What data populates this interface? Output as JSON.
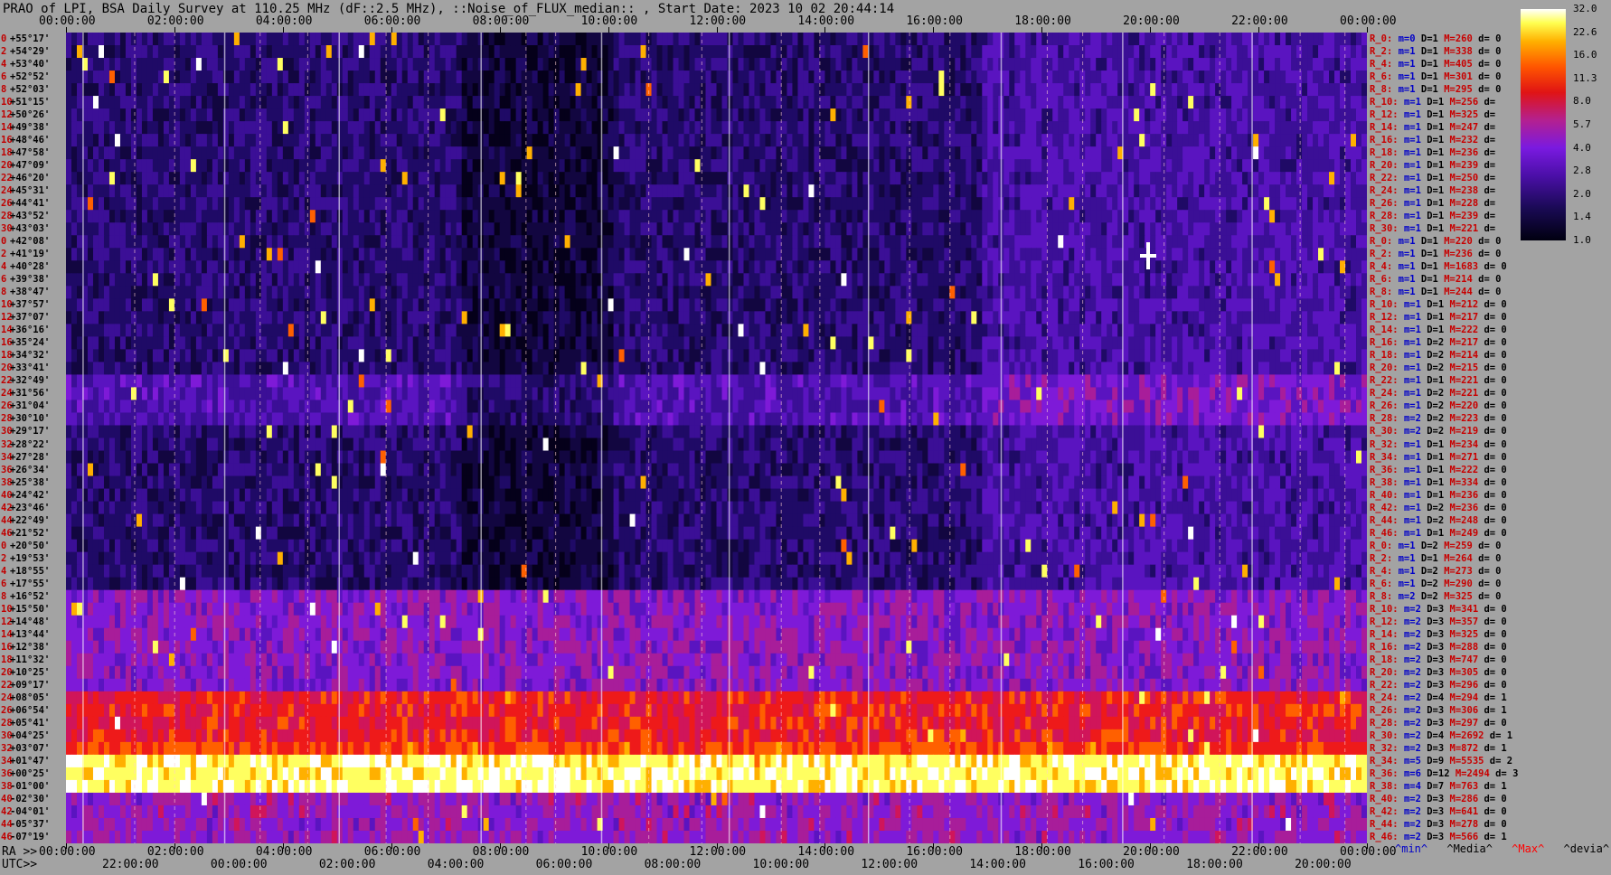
{
  "title": "PRAO of LPI, BSA Daily Survey at 110.25 MHz (dF::2.5 MHz), ::Noise_of_FLUX_median:: , Start Date: 2023 10 02 20:44:14",
  "ra_prefix": "RA >>",
  "utc_prefix": "UTC>>",
  "top_ticks": [
    "00:00:00",
    "02:00:00",
    "04:00:00",
    "06:00:00",
    "08:00:00",
    "10:00:00",
    "12:00:00",
    "14:00:00",
    "16:00:00",
    "18:00:00",
    "20:00:00",
    "22:00:00",
    "00:00:00"
  ],
  "bottom_ticks": [
    "00:00:00",
    "02:00:00",
    "04:00:00",
    "06:00:00",
    "08:00:00",
    "10:00:00",
    "12:00:00",
    "14:00:00",
    "16:00:00",
    "18:00:00",
    "20:00:00",
    "22:00:00",
    "00:00:00"
  ],
  "utc_ticks": [
    "22:00:00",
    "00:00:00",
    "02:00:00",
    "04:00:00",
    "06:00:00",
    "08:00:00",
    "10:00:00",
    "12:00:00",
    "14:00:00",
    "16:00:00",
    "18:00:00",
    "20:00:00"
  ],
  "colorbar_ticks": [
    "32.0",
    "22.6",
    "16.0",
    "11.3",
    "8.0",
    "5.7",
    "4.0",
    "2.8",
    "2.0",
    "1.4",
    "1.0"
  ],
  "legend": {
    "min": "^min^",
    "median": "^Media^",
    "max": "^Max^",
    "devia": "^devia^"
  },
  "colors": {
    "bg": "#a3a3a3",
    "red_label": "#c80000",
    "blue_label": "#0000c8",
    "max_label": "#ff0000"
  },
  "chart_data": {
    "type": "heatmap",
    "title": "PRAO of LPI, BSA Daily Survey at 110.25 MHz (dF::2.5 MHz), ::Noise_of_FLUX_median:: , Start Date: 2023 10 02 20:44:14",
    "x_axis_ticks": [
      "00:00:00",
      "02:00:00",
      "04:00:00",
      "06:00:00",
      "08:00:00",
      "10:00:00",
      "12:00:00",
      "14:00:00",
      "16:00:00",
      "18:00:00",
      "20:00:00",
      "22:00:00",
      "00:00:00"
    ],
    "colorbar_range": [
      1.0,
      32.0
    ],
    "colorbar_scale": "log",
    "rows": [
      {
        "idx": "0",
        "dec": "+55°17'",
        "r": "R_0:",
        "m": "m=0",
        "d": "D=1",
        "h": "M=260",
        "dv": "d= 0"
      },
      {
        "idx": "2",
        "dec": "+54°29'",
        "r": "R_2:",
        "m": "m=1",
        "d": "D=1",
        "h": "M=338",
        "dv": "d= 0"
      },
      {
        "idx": "4",
        "dec": "+53°40'",
        "r": "R_4:",
        "m": "m=1",
        "d": "D=1",
        "h": "M=405",
        "dv": "d= 0"
      },
      {
        "idx": "6",
        "dec": "+52°52'",
        "r": "R_6:",
        "m": "m=1",
        "d": "D=1",
        "h": "M=301",
        "dv": "d= 0"
      },
      {
        "idx": "8",
        "dec": "+52°03'",
        "r": "R_8:",
        "m": "m=1",
        "d": "D=1",
        "h": "M=295",
        "dv": "d= 0"
      },
      {
        "idx": "10",
        "dec": "+51°15'",
        "r": "R_10:",
        "m": "m=1",
        "d": "D=1",
        "h": "M=256",
        "dv": "d="
      },
      {
        "idx": "12",
        "dec": "+50°26'",
        "r": "R_12:",
        "m": "m=1",
        "d": "D=1",
        "h": "M=325",
        "dv": "d="
      },
      {
        "idx": "14",
        "dec": "+49°38'",
        "r": "R_14:",
        "m": "m=1",
        "d": "D=1",
        "h": "M=247",
        "dv": "d="
      },
      {
        "idx": "16",
        "dec": "+48°46'",
        "r": "R_16:",
        "m": "m=1",
        "d": "D=1",
        "h": "M=232",
        "dv": "d="
      },
      {
        "idx": "18",
        "dec": "+47°58'",
        "r": "R_18:",
        "m": "m=1",
        "d": "D=1",
        "h": "M=236",
        "dv": "d="
      },
      {
        "idx": "20",
        "dec": "+47°09'",
        "r": "R_20:",
        "m": "m=1",
        "d": "D=1",
        "h": "M=239",
        "dv": "d="
      },
      {
        "idx": "22",
        "dec": "+46°20'",
        "r": "R_22:",
        "m": "m=1",
        "d": "D=1",
        "h": "M=250",
        "dv": "d="
      },
      {
        "idx": "24",
        "dec": "+45°31'",
        "r": "R_24:",
        "m": "m=1",
        "d": "D=1",
        "h": "M=238",
        "dv": "d="
      },
      {
        "idx": "26",
        "dec": "+44°41'",
        "r": "R_26:",
        "m": "m=1",
        "d": "D=1",
        "h": "M=228",
        "dv": "d="
      },
      {
        "idx": "28",
        "dec": "+43°52'",
        "r": "R_28:",
        "m": "m=1",
        "d": "D=1",
        "h": "M=239",
        "dv": "d="
      },
      {
        "idx": "30",
        "dec": "+43°03'",
        "r": "R_30:",
        "m": "m=1",
        "d": "D=1",
        "h": "M=221",
        "dv": "d="
      },
      {
        "idx": "0",
        "dec": "+42°08'",
        "r": "R_0:",
        "m": "m=1",
        "d": "D=1",
        "h": "M=220",
        "dv": "d= 0"
      },
      {
        "idx": "2",
        "dec": "+41°19'",
        "r": "R_2:",
        "m": "m=1",
        "d": "D=1",
        "h": "M=236",
        "dv": "d= 0"
      },
      {
        "idx": "4",
        "dec": "+40°28'",
        "r": "R_4:",
        "m": "m=1",
        "d": "D=1",
        "h": "M=1683",
        "dv": "d= 0"
      },
      {
        "idx": "6",
        "dec": "+39°38'",
        "r": "R_6:",
        "m": "m=1",
        "d": "D=1",
        "h": "M=214",
        "dv": "d= 0"
      },
      {
        "idx": "8",
        "dec": "+38°47'",
        "r": "R_8:",
        "m": "m=1",
        "d": "D=1",
        "h": "M=244",
        "dv": "d= 0"
      },
      {
        "idx": "10",
        "dec": "+37°57'",
        "r": "R_10:",
        "m": "m=1",
        "d": "D=1",
        "h": "M=212",
        "dv": "d= 0"
      },
      {
        "idx": "12",
        "dec": "+37°07'",
        "r": "R_12:",
        "m": "m=1",
        "d": "D=1",
        "h": "M=217",
        "dv": "d= 0"
      },
      {
        "idx": "14",
        "dec": "+36°16'",
        "r": "R_14:",
        "m": "m=1",
        "d": "D=1",
        "h": "M=222",
        "dv": "d= 0"
      },
      {
        "idx": "16",
        "dec": "+35°24'",
        "r": "R_16:",
        "m": "m=1",
        "d": "D=2",
        "h": "M=217",
        "dv": "d= 0"
      },
      {
        "idx": "18",
        "dec": "+34°32'",
        "r": "R_18:",
        "m": "m=1",
        "d": "D=2",
        "h": "M=214",
        "dv": "d= 0"
      },
      {
        "idx": "20",
        "dec": "+33°41'",
        "r": "R_20:",
        "m": "m=1",
        "d": "D=2",
        "h": "M=215",
        "dv": "d= 0"
      },
      {
        "idx": "22",
        "dec": "+32°49'",
        "r": "R_22:",
        "m": "m=1",
        "d": "D=1",
        "h": "M=221",
        "dv": "d= 0"
      },
      {
        "idx": "24",
        "dec": "+31°56'",
        "r": "R_24:",
        "m": "m=1",
        "d": "D=2",
        "h": "M=221",
        "dv": "d= 0"
      },
      {
        "idx": "26",
        "dec": "+31°04'",
        "r": "R_26:",
        "m": "m=1",
        "d": "D=2",
        "h": "M=220",
        "dv": "d= 0"
      },
      {
        "idx": "28",
        "dec": "+30°10'",
        "r": "R_28:",
        "m": "m=2",
        "d": "D=2",
        "h": "M=223",
        "dv": "d= 0"
      },
      {
        "idx": "30",
        "dec": "+29°17'",
        "r": "R_30:",
        "m": "m=2",
        "d": "D=2",
        "h": "M=219",
        "dv": "d= 0"
      },
      {
        "idx": "32",
        "dec": "+28°22'",
        "r": "R_32:",
        "m": "m=1",
        "d": "D=1",
        "h": "M=234",
        "dv": "d= 0"
      },
      {
        "idx": "34",
        "dec": "+27°28'",
        "r": "R_34:",
        "m": "m=1",
        "d": "D=1",
        "h": "M=271",
        "dv": "d= 0"
      },
      {
        "idx": "36",
        "dec": "+26°34'",
        "r": "R_36:",
        "m": "m=1",
        "d": "D=1",
        "h": "M=222",
        "dv": "d= 0"
      },
      {
        "idx": "38",
        "dec": "+25°38'",
        "r": "R_38:",
        "m": "m=1",
        "d": "D=1",
        "h": "M=334",
        "dv": "d= 0"
      },
      {
        "idx": "40",
        "dec": "+24°42'",
        "r": "R_40:",
        "m": "m=1",
        "d": "D=1",
        "h": "M=236",
        "dv": "d= 0"
      },
      {
        "idx": "42",
        "dec": "+23°46'",
        "r": "R_42:",
        "m": "m=1",
        "d": "D=2",
        "h": "M=236",
        "dv": "d= 0"
      },
      {
        "idx": "44",
        "dec": "+22°49'",
        "r": "R_44:",
        "m": "m=1",
        "d": "D=2",
        "h": "M=248",
        "dv": "d= 0"
      },
      {
        "idx": "46",
        "dec": "+21°52'",
        "r": "R_46:",
        "m": "m=1",
        "d": "D=1",
        "h": "M=249",
        "dv": "d= 0"
      },
      {
        "idx": "0",
        "dec": "+20°50'",
        "r": "R_0:",
        "m": "m=1",
        "d": "D=2",
        "h": "M=259",
        "dv": "d= 0"
      },
      {
        "idx": "2",
        "dec": "+19°53'",
        "r": "R_2:",
        "m": "m=1",
        "d": "D=1",
        "h": "M=264",
        "dv": "d= 0"
      },
      {
        "idx": "4",
        "dec": "+18°55'",
        "r": "R_4:",
        "m": "m=1",
        "d": "D=2",
        "h": "M=273",
        "dv": "d= 0"
      },
      {
        "idx": "6",
        "dec": "+17°55'",
        "r": "R_6:",
        "m": "m=1",
        "d": "D=2",
        "h": "M=290",
        "dv": "d= 0"
      },
      {
        "idx": "8",
        "dec": "+16°52'",
        "r": "R_8:",
        "m": "m=2",
        "d": "D=2",
        "h": "M=325",
        "dv": "d= 0"
      },
      {
        "idx": "10",
        "dec": "+15°50'",
        "r": "R_10:",
        "m": "m=2",
        "d": "D=3",
        "h": "M=341",
        "dv": "d= 0"
      },
      {
        "idx": "12",
        "dec": "+14°48'",
        "r": "R_12:",
        "m": "m=2",
        "d": "D=3",
        "h": "M=357",
        "dv": "d= 0"
      },
      {
        "idx": "14",
        "dec": "+13°44'",
        "r": "R_14:",
        "m": "m=2",
        "d": "D=3",
        "h": "M=325",
        "dv": "d= 0"
      },
      {
        "idx": "16",
        "dec": "+12°38'",
        "r": "R_16:",
        "m": "m=2",
        "d": "D=3",
        "h": "M=288",
        "dv": "d= 0"
      },
      {
        "idx": "18",
        "dec": "+11°32'",
        "r": "R_18:",
        "m": "m=2",
        "d": "D=3",
        "h": "M=747",
        "dv": "d= 0"
      },
      {
        "idx": "20",
        "dec": "+10°25'",
        "r": "R_20:",
        "m": "m=2",
        "d": "D=3",
        "h": "M=305",
        "dv": "d= 0"
      },
      {
        "idx": "22",
        "dec": "+09°17'",
        "r": "R_22:",
        "m": "m=2",
        "d": "D=3",
        "h": "M=296",
        "dv": "d= 0"
      },
      {
        "idx": "24",
        "dec": "+08°05'",
        "r": "R_24:",
        "m": "m=2",
        "d": "D=4",
        "h": "M=294",
        "dv": "d= 1"
      },
      {
        "idx": "26",
        "dec": "+06°54'",
        "r": "R_26:",
        "m": "m=2",
        "d": "D=3",
        "h": "M=306",
        "dv": "d= 1"
      },
      {
        "idx": "28",
        "dec": "+05°41'",
        "r": "R_28:",
        "m": "m=2",
        "d": "D=3",
        "h": "M=297",
        "dv": "d= 0"
      },
      {
        "idx": "30",
        "dec": "+04°25'",
        "r": "R_30:",
        "m": "m=2",
        "d": "D=4",
        "h": "M=2692",
        "dv": "d= 1"
      },
      {
        "idx": "32",
        "dec": "+03°07'",
        "r": "R_32:",
        "m": "m=2",
        "d": "D=3",
        "h": "M=872",
        "dv": "d= 1"
      },
      {
        "idx": "34",
        "dec": "+01°47'",
        "r": "R_34:",
        "m": "m=5",
        "d": "D=9",
        "h": "M=5535",
        "dv": "d= 2"
      },
      {
        "idx": "36",
        "dec": "+00°25'",
        "r": "R_36:",
        "m": "m=6",
        "d": "D=12",
        "h": "M=2494",
        "dv": "d= 3"
      },
      {
        "idx": "38",
        "dec": "-01°00'",
        "r": "R_38:",
        "m": "m=4",
        "d": "D=7",
        "h": "M=763",
        "dv": "d= 1"
      },
      {
        "idx": "40",
        "dec": "-02°30'",
        "r": "R_40:",
        "m": "m=2",
        "d": "D=3",
        "h": "M=286",
        "dv": "d= 0"
      },
      {
        "idx": "42",
        "dec": "-04°01'",
        "r": "R_42:",
        "m": "m=2",
        "d": "D=3",
        "h": "M=641",
        "dv": "d= 0"
      },
      {
        "idx": "44",
        "dec": "-05°37'",
        "r": "R_44:",
        "m": "m=2",
        "d": "D=3",
        "h": "M=278",
        "dv": "d= 0"
      },
      {
        "idx": "46",
        "dec": "-07°19'",
        "r": "R_46:",
        "m": "m=2",
        "d": "D=3",
        "h": "M=566",
        "dv": "d= 1"
      }
    ]
  }
}
